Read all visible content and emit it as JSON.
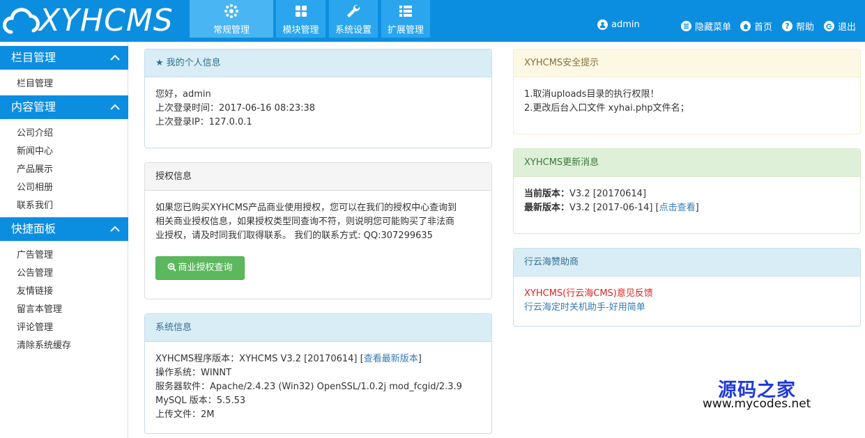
{
  "header": {
    "logo_text": "XYHCMS",
    "tabs": [
      {
        "label": "常规管理",
        "icon": "gear-flower-icon"
      },
      {
        "label": "模块管理",
        "icon": "grid-icon"
      },
      {
        "label": "系统设置",
        "icon": "wrench-icon"
      },
      {
        "label": "扩展管理",
        "icon": "list-icon"
      }
    ],
    "user": "admin",
    "links": {
      "hide_menu": "隐藏菜单",
      "home": "首页",
      "help": "帮助",
      "logout": "退出"
    },
    "colors": {
      "bar": "#0c8ee0",
      "tab": "#2ba6ee"
    }
  },
  "sidebar": {
    "sections": [
      {
        "title": "栏目管理",
        "items": [
          "栏目管理"
        ]
      },
      {
        "title": "内容管理",
        "items": [
          "公司介绍",
          "新闻中心",
          "产品展示",
          "公司相册",
          "联系我们"
        ]
      },
      {
        "title": "快捷面板",
        "items": [
          "广告管理",
          "公告管理",
          "友情链接",
          "留言本管理",
          "评论管理",
          "清除系统缓存"
        ]
      }
    ]
  },
  "panels": {
    "profile": {
      "title": "我的个人信息",
      "greeting": "您好，admin",
      "last_login_time": "上次登录时间：2017-06-16 08:23:38",
      "last_login_ip": "上次登录IP：127.0.0.1"
    },
    "license": {
      "title": "授权信息",
      "line1": "如果您已购买XYHCMS产品商业使用授权，您可以在我们的授权中心查询到",
      "line2": "相关商业授权信息，如果授权类型同查询不符，则说明您可能购买了非法商",
      "line3": "业授权，请及时同我们取得联系。 我们的联系方式: QQ:307299635",
      "button": "商业授权查询"
    },
    "system": {
      "title": "系统信息",
      "version_prefix": "XYHCMS程序版本：XYHCMS V3.2 [20170614] [",
      "version_link": "查看最新版本",
      "version_suffix": "]",
      "os": "操作系统：WINNT",
      "server": "服务器软件：Apache/2.4.23 (Win32) OpenSSL/1.0.2j mod_fcgid/2.3.9",
      "mysql": "MySQL 版本：5.5.53",
      "upload": "上传文件：2M"
    },
    "security": {
      "title": "XYHCMS安全提示",
      "tip1": "1.取消uploads目录的执行权限！",
      "tip2": "2.更改后台入口文件 xyhai.php文件名；"
    },
    "update": {
      "title": "XYHCMS更新消息",
      "current_label": "当前版本：",
      "current_value": "V3.2 [20170614]",
      "latest_label": "最新版本：",
      "latest_value": "V3.2 [2017-06-14] [",
      "latest_link": "点击查看",
      "latest_suffix": "]"
    },
    "sponsor": {
      "title": "行云海赞助商",
      "link1": "XYHCMS(行云海CMS)意见反馈",
      "link2": "行云海定时关机助手-好用简单"
    }
  },
  "watermark": {
    "cn": "源码之家",
    "url": "www.mycodes.net"
  }
}
